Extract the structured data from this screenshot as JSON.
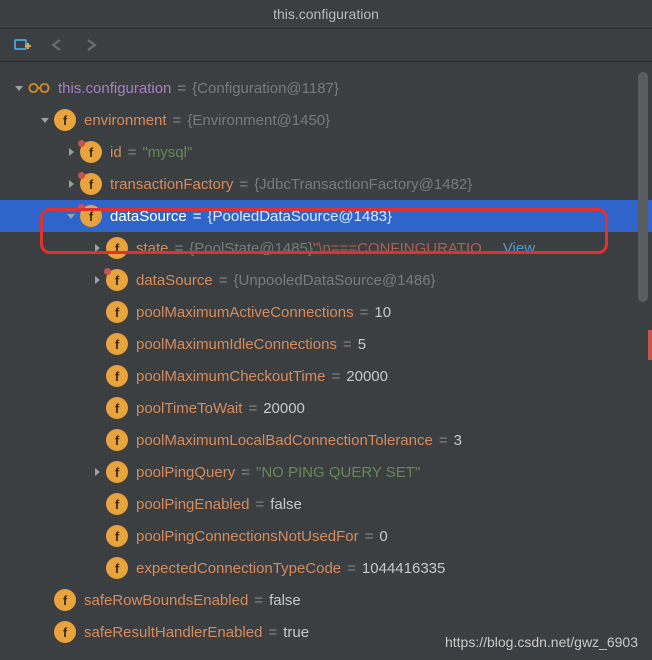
{
  "title": "this.configuration",
  "watermark": "https://blog.csdn.net/gwz_6903",
  "viewLink": "View",
  "rows": [
    {
      "indent": 0,
      "arrow": "down",
      "kind": "glasses",
      "name": "this.configuration",
      "nameClass": "purple",
      "eq": "=",
      "valText": "{Configuration@1187}",
      "valClass": "val-gray"
    },
    {
      "indent": 1,
      "arrow": "down",
      "kind": "f",
      "name": "environment",
      "eq": "=",
      "valText": "{Environment@1450}",
      "valClass": "val-gray"
    },
    {
      "indent": 2,
      "arrow": "right",
      "kind": "f",
      "dot": true,
      "name": "id",
      "eq": "=",
      "valText": "\"mysql\"",
      "valClass": "val-green"
    },
    {
      "indent": 2,
      "arrow": "right",
      "kind": "f",
      "dot": true,
      "name": "transactionFactory",
      "eq": "=",
      "valText": "{JdbcTransactionFactory@1482}",
      "valClass": "val-gray"
    },
    {
      "indent": 2,
      "arrow": "down",
      "kind": "f",
      "dot": true,
      "name": "dataSource",
      "eq": "=",
      "valText": "{PooledDataSource@1483}",
      "valClass": "val-gray",
      "selected": true
    },
    {
      "indent": 3,
      "arrow": "right",
      "kind": "f",
      "name": "state",
      "eq": "=",
      "valText": "{PoolState@1485}",
      "valClass": "val-gray",
      "extra": "\"\\n===CONFINGURATIO…",
      "extraClass": "val-red",
      "link": true
    },
    {
      "indent": 3,
      "arrow": "right",
      "kind": "f",
      "dot": true,
      "name": "dataSource",
      "eq": "=",
      "valText": "{UnpooledDataSource@1486}",
      "valClass": "val-gray"
    },
    {
      "indent": 3,
      "arrow": "none",
      "kind": "f",
      "name": "poolMaximumActiveConnections",
      "eq": "=",
      "valText": "10",
      "valClass": "val-white"
    },
    {
      "indent": 3,
      "arrow": "none",
      "kind": "f",
      "name": "poolMaximumIdleConnections",
      "eq": "=",
      "valText": "5",
      "valClass": "val-white"
    },
    {
      "indent": 3,
      "arrow": "none",
      "kind": "f",
      "name": "poolMaximumCheckoutTime",
      "eq": "=",
      "valText": "20000",
      "valClass": "val-white"
    },
    {
      "indent": 3,
      "arrow": "none",
      "kind": "f",
      "name": "poolTimeToWait",
      "eq": "=",
      "valText": "20000",
      "valClass": "val-white"
    },
    {
      "indent": 3,
      "arrow": "none",
      "kind": "f",
      "name": "poolMaximumLocalBadConnectionTolerance",
      "eq": "=",
      "valText": "3",
      "valClass": "val-white"
    },
    {
      "indent": 3,
      "arrow": "right",
      "kind": "f",
      "name": "poolPingQuery",
      "eq": "=",
      "valText": "\"NO PING QUERY SET\"",
      "valClass": "val-green"
    },
    {
      "indent": 3,
      "arrow": "none",
      "kind": "f",
      "name": "poolPingEnabled",
      "eq": "=",
      "valText": "false",
      "valClass": "val-white"
    },
    {
      "indent": 3,
      "arrow": "none",
      "kind": "f",
      "name": "poolPingConnectionsNotUsedFor",
      "eq": "=",
      "valText": "0",
      "valClass": "val-white"
    },
    {
      "indent": 3,
      "arrow": "none",
      "kind": "f",
      "name": "expectedConnectionTypeCode",
      "eq": "=",
      "valText": "1044416335",
      "valClass": "val-white"
    },
    {
      "indent": 1,
      "arrow": "none",
      "kind": "f",
      "name": "safeRowBoundsEnabled",
      "eq": "=",
      "valText": "false",
      "valClass": "val-white"
    },
    {
      "indent": 1,
      "arrow": "none",
      "kind": "f",
      "name": "safeResultHandlerEnabled",
      "eq": "=",
      "valText": "true",
      "valClass": "val-white"
    }
  ]
}
